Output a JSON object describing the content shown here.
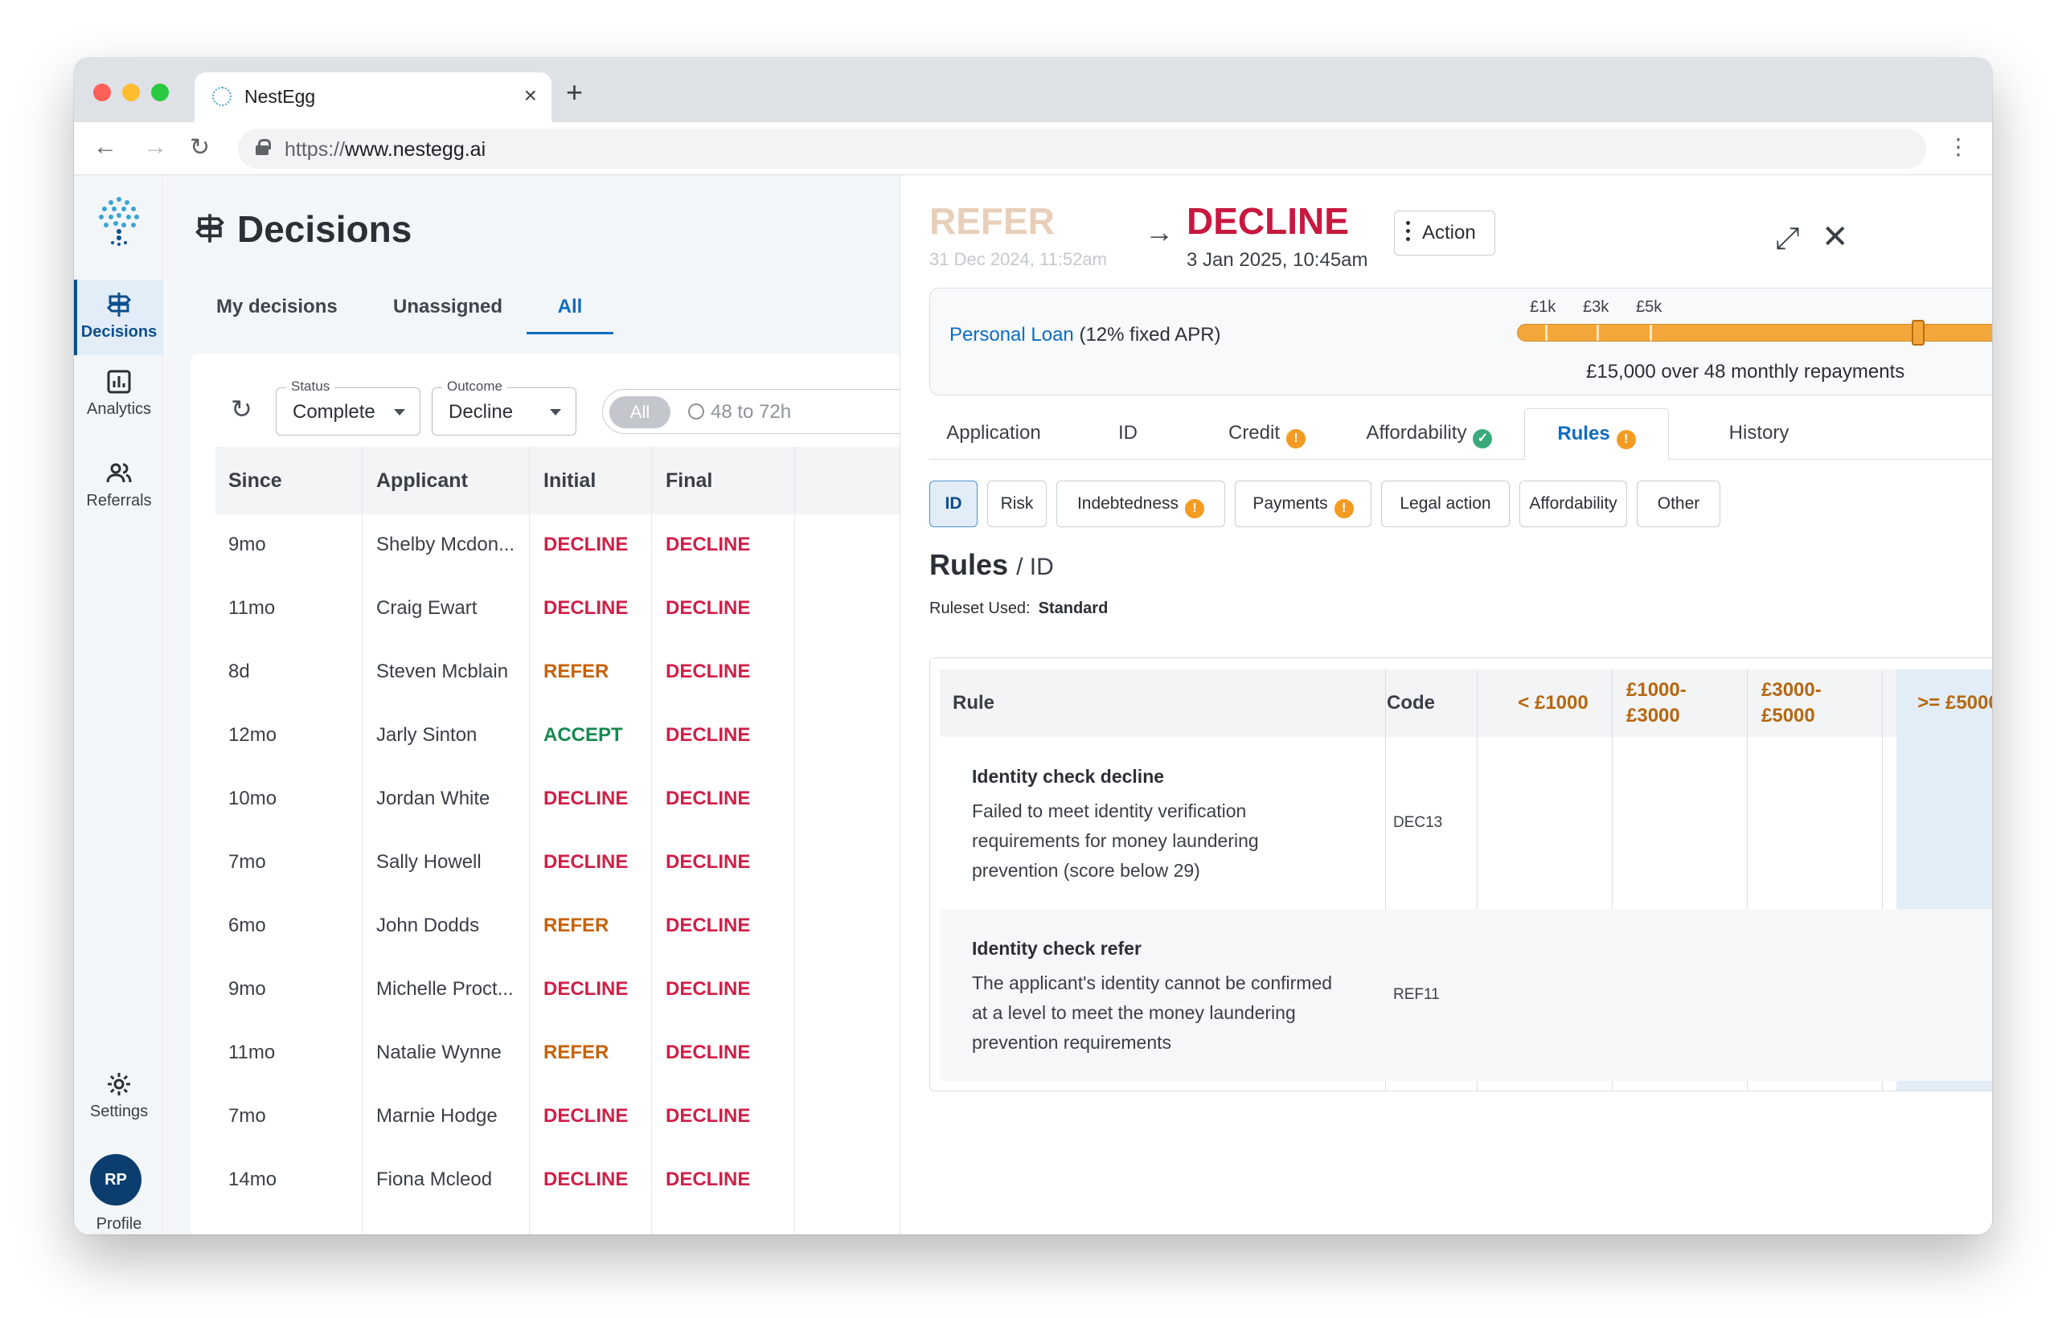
{
  "browser": {
    "tab_title": "NestEgg",
    "url_scheme": "https://",
    "url_host": "www.nestegg.ai"
  },
  "sidebar": {
    "items": [
      {
        "label": "Decisions",
        "icon": "signpost-icon"
      },
      {
        "label": "Analytics",
        "icon": "bar-chart-icon"
      },
      {
        "label": "Referrals",
        "icon": "people-icon"
      }
    ],
    "settings_label": "Settings",
    "avatar_initials": "RP",
    "profile_label": "Profile"
  },
  "main": {
    "title": "Decisions",
    "tabs": [
      {
        "label": "My decisions"
      },
      {
        "label": "Unassigned"
      },
      {
        "label": "All"
      }
    ],
    "filters": {
      "status_label": "Status",
      "status_value": "Complete",
      "outcome_label": "Outcome",
      "outcome_value": "Decline",
      "time_all": "All",
      "time_range": "48 to 72h"
    },
    "table": {
      "headers": [
        "Since",
        "Applicant",
        "Initial",
        "Final"
      ],
      "rows": [
        {
          "since": "9mo",
          "applicant": "Shelby Mcdon...",
          "initial": "DECLINE",
          "final": "DECLINE"
        },
        {
          "since": "11mo",
          "applicant": "Craig Ewart",
          "initial": "DECLINE",
          "final": "DECLINE"
        },
        {
          "since": "8d",
          "applicant": "Steven Mcblain",
          "initial": "REFER",
          "final": "DECLINE"
        },
        {
          "since": "12mo",
          "applicant": "Jarly Sinton",
          "initial": "ACCEPT",
          "final": "DECLINE"
        },
        {
          "since": "10mo",
          "applicant": "Jordan White",
          "initial": "DECLINE",
          "final": "DECLINE"
        },
        {
          "since": "7mo",
          "applicant": "Sally Howell",
          "initial": "DECLINE",
          "final": "DECLINE"
        },
        {
          "since": "6mo",
          "applicant": "John Dodds",
          "initial": "REFER",
          "final": "DECLINE"
        },
        {
          "since": "9mo",
          "applicant": "Michelle Proct...",
          "initial": "DECLINE",
          "final": "DECLINE"
        },
        {
          "since": "11mo",
          "applicant": "Natalie Wynne",
          "initial": "REFER",
          "final": "DECLINE"
        },
        {
          "since": "7mo",
          "applicant": "Marnie Hodge",
          "initial": "DECLINE",
          "final": "DECLINE"
        },
        {
          "since": "14mo",
          "applicant": "Fiona Mcleod",
          "initial": "DECLINE",
          "final": "DECLINE"
        }
      ]
    }
  },
  "panel": {
    "initial_decision": "REFER",
    "initial_date": "31 Dec 2024, 11:52am",
    "final_decision": "DECLINE",
    "final_date": "3 Jan 2025, 10:45am",
    "action_label": "Action",
    "loan": {
      "product_link": "Personal Loan",
      "product_rate": " (12% fixed APR)",
      "ticks": [
        "£1k",
        "£3k",
        "£5k"
      ],
      "slider_fraction": 0.83,
      "summary": "£15,000 over 48 monthly repayments"
    },
    "tabs": [
      {
        "label": "Application",
        "badge": ""
      },
      {
        "label": "ID",
        "badge": ""
      },
      {
        "label": "Credit",
        "badge": "warn"
      },
      {
        "label": "Affordability",
        "badge": "ok"
      },
      {
        "label": "Rules",
        "badge": "warn"
      },
      {
        "label": "History",
        "badge": ""
      }
    ],
    "subtabs": [
      {
        "label": "ID",
        "badge": ""
      },
      {
        "label": "Risk",
        "badge": ""
      },
      {
        "label": "Indebtedness",
        "badge": "warn"
      },
      {
        "label": "Payments",
        "badge": "warn"
      },
      {
        "label": "Legal action",
        "badge": ""
      },
      {
        "label": "Affordability",
        "badge": ""
      },
      {
        "label": "Other",
        "badge": ""
      }
    ],
    "rules_title": "Rules",
    "rules_sub": "/ ID",
    "ruleset_label": "Ruleset Used:",
    "ruleset_value": "Standard",
    "rules_table": {
      "headers": {
        "rule": "Rule",
        "code": "Code",
        "band1": "< £1000",
        "band2": "£1000-£3000",
        "band3": "£3000-£5000",
        "band4": ">= £5000"
      },
      "rows": [
        {
          "title": "Identity check decline",
          "desc": "Failed to meet identity verification requirements for money laundering prevention (score below 29)",
          "code": "DEC13"
        },
        {
          "title": "Identity check refer",
          "desc": "The applicant's identity cannot be confirmed at a level to meet the money laundering prevention requirements",
          "code": "REF11"
        }
      ]
    }
  },
  "colors": {
    "accent": "#0d6cc2",
    "decline": "#d01f47",
    "refer": "#c7620a",
    "accept": "#16884f",
    "slider": "#f3a73b"
  }
}
